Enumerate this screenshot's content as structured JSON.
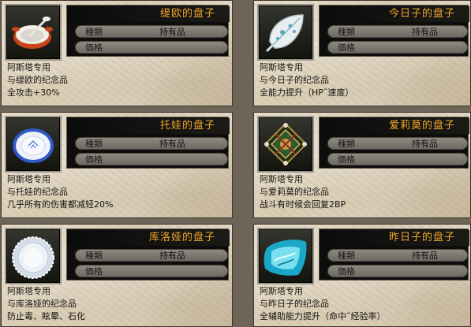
{
  "labels": {
    "type": "種類",
    "price": "価格"
  },
  "items": [
    {
      "title": "缇欧的盘子",
      "type_value": "持有品",
      "price_value": "",
      "desc": [
        "阿斯塔专用",
        "与缇欧的纪念品",
        "全攻击+30%"
      ],
      "icon": "red-bowl-icon"
    },
    {
      "title": "今日子的盘子",
      "type_value": "持有品",
      "price_value": "",
      "desc": [
        "阿斯塔专用",
        "与今日子的纪念品",
        "全能力提升（HP˜速度）"
      ],
      "icon": "leaf-plate-icon"
    },
    {
      "title": "托娃的盘子",
      "type_value": "持有品",
      "price_value": "",
      "desc": [
        "阿斯塔专用",
        "与托娃的纪念品",
        "几乎所有的伤害都减轻20%"
      ],
      "icon": "blue-plate-icon"
    },
    {
      "title": "爱莉莫的盘子",
      "type_value": "持有品",
      "price_value": "",
      "desc": [
        "阿斯塔专用",
        "与爱莉莫的纪念品",
        "战斗有时候会回复2BP"
      ],
      "icon": "ornate-plate-icon"
    },
    {
      "title": "库洛娅的盘子",
      "type_value": "持有品",
      "price_value": "",
      "desc": [
        "阿斯塔专用",
        "与库洛娅的纪念品",
        "防止毒、眩晕、石化"
      ],
      "icon": "lace-plate-icon"
    },
    {
      "title": "昨日子的盘子",
      "type_value": "持有品",
      "price_value": "",
      "desc": [
        "阿斯塔专用",
        "与昨日子的纪念品",
        "全辅助能力提升（命中˜经验率）"
      ],
      "icon": "cyan-plate-icon"
    }
  ]
}
